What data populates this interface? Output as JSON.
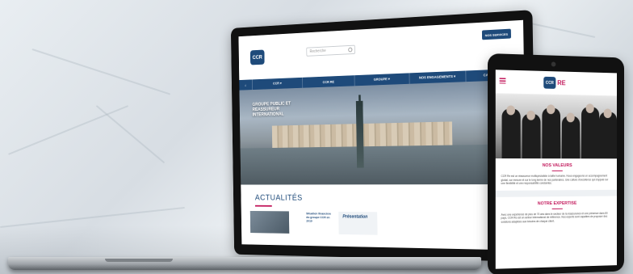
{
  "laptop": {
    "site": {
      "logo": "CCR",
      "search_placeholder": "Recherche",
      "cta_button": "NOS SERVICES",
      "nav": [
        "",
        "CCR ▾",
        "CCR RE",
        "GROUPE ▾",
        "NOS ENGAGEMENTS ▾",
        "CARRIÈRES ▾"
      ],
      "hero_caption": "GROUPE PUBLIC ET REASSUREUR INTERNATIONAL",
      "news_title": "ACTUALITÉS",
      "news_card_text": "Situation financière du groupe CCR en 2019",
      "news_card_pres": "Présentation"
    }
  },
  "tablet": {
    "logo": "CCR",
    "logo_suffix": "RE",
    "section1_title": "NOS VALEURS",
    "section1_text": "CCR Re est un réassureur multispécialiste à taille humaine. Nous engageons un accompagnement global, sur mesure et sur le long terme de nos partenaires. Une culture d'excellence qui s'appuie sur une flexibilité et une responsabilité constantes.",
    "section2_title": "NOTRE EXPERTISE",
    "section2_text": "Avec une expérience de plus de 70 ans dans le secteur de la réassurance et une présence dans 80 pays, CCR Re est un acteur international de référence. Nos experts sont capables de proposer des solutions adaptées aux besoins de chaque client."
  },
  "colors": {
    "brand_blue": "#1e4a7a",
    "accent_pink": "#c2185b"
  }
}
